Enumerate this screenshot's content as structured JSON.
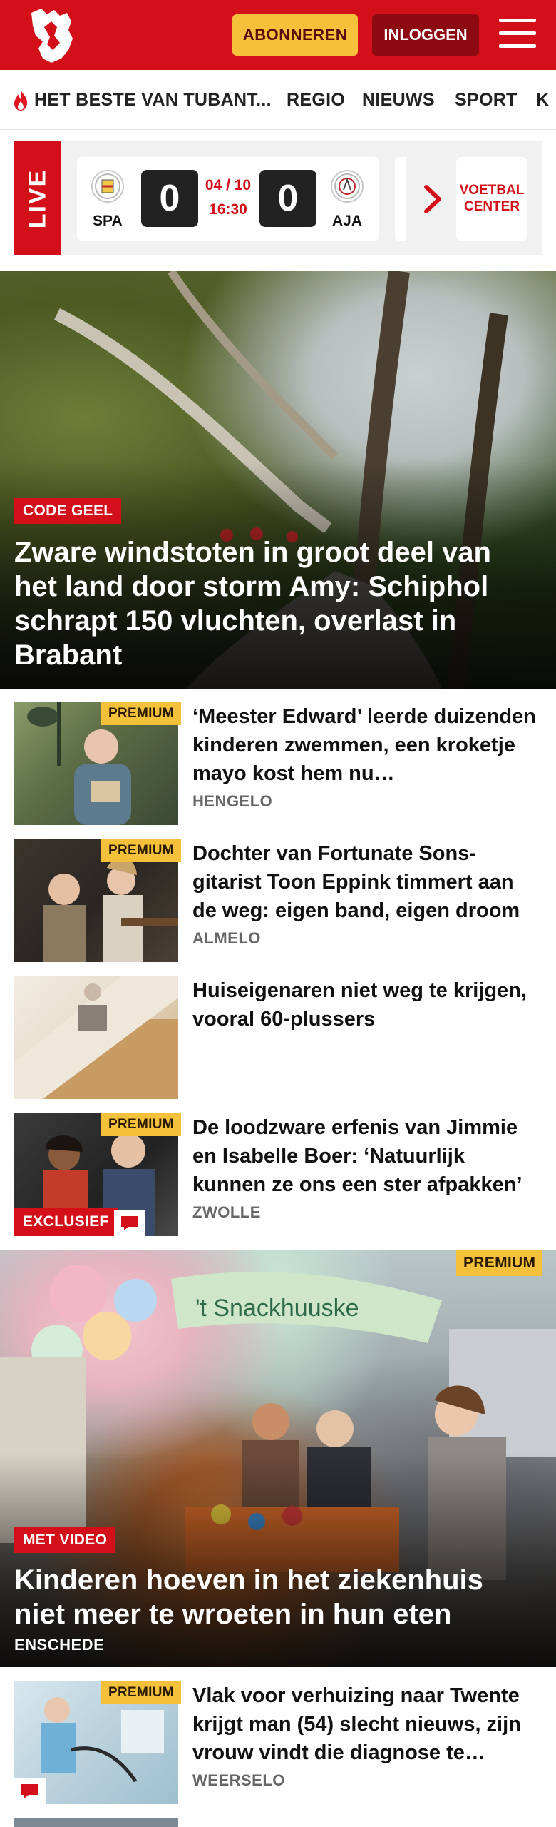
{
  "header": {
    "subscribe_label": "ABONNEREN",
    "login_label": "INLOGGEN",
    "logo_icon": "tubantia-horse-logo-icon",
    "menu_icon": "hamburger-menu-icon",
    "brand_color": "#d3101a"
  },
  "nav": {
    "items": [
      {
        "label": "HET BESTE VAN TUBANT...",
        "icon": "flame-icon"
      },
      {
        "label": "REGIO"
      },
      {
        "label": "NIEUWS"
      },
      {
        "label": "SPORT"
      },
      {
        "label": "K"
      }
    ]
  },
  "live": {
    "label": "LIVE",
    "match": {
      "home": "SPA",
      "away": "AJA",
      "home_score": "0",
      "away_score": "0",
      "date": "04 / 10",
      "time": "16:30"
    },
    "voetbal_center": "VOETBAL CENTER"
  },
  "hero1": {
    "label": "CODE GEEL",
    "title": "Zware windstoten in groot deel van het land door storm Amy: Schiphol schrapt 150 vluchten, overlast in Brabant"
  },
  "articles": [
    {
      "premium": "PREMIUM",
      "title": "‘Meester Edward’ leerde duizenden kinderen zwemmen, een kroketje mayo kost hem nu…",
      "location": "HENGELO"
    },
    {
      "premium": "PREMIUM",
      "title": "Dochter van Fortunate Sons-gitarist Toon Eppink timmert aan de weg: eigen band, eigen droom",
      "location": "ALMELO"
    },
    {
      "premium": "",
      "title": "Huiseigenaren niet weg te krijgen, vooral 60-plussers",
      "location": ""
    },
    {
      "premium": "PREMIUM",
      "badge": "EXCLUSIEF",
      "title": "De loodzware erfenis van Jimmie en Isabelle Boer: ‘Natuurlijk kunnen ze ons een ster afpakken’",
      "location": "ZWOLLE"
    }
  ],
  "hero2": {
    "premium": "PREMIUM",
    "label": "MET VIDEO",
    "title": "Kinderen hoeven in het ziekenhuis niet meer te wroeten in hun eten",
    "location": "ENSCHEDE",
    "sign_text": "'t Snackhuuske"
  },
  "article5": {
    "premium": "PREMIUM",
    "title": "Vlak voor verhuizing naar Twente krijgt man (54) slecht nieuws, zijn vrouw vindt die diagnose te…",
    "location": "WEERSELO"
  }
}
